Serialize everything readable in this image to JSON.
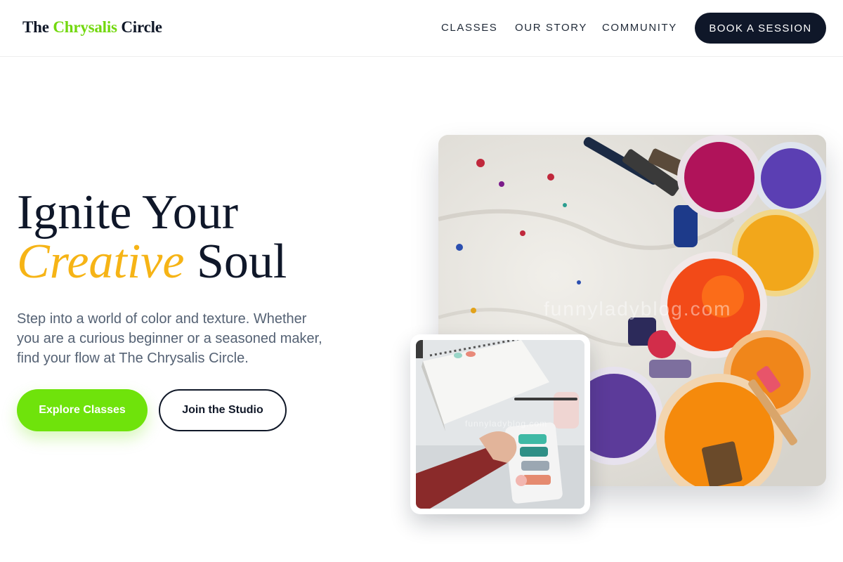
{
  "header": {
    "logo": {
      "prefix": "The",
      "accent": "Chrysalis",
      "suffix": "Circle"
    },
    "nav": {
      "classes": "CLASSES",
      "story": "OUR STORY",
      "community": "COMMUNITY"
    },
    "cta": "BOOK A SESSION"
  },
  "hero": {
    "headline_line1": "Ignite Your",
    "headline_accent": "Creative",
    "headline_line2_rest": "Soul",
    "subtext": "Step into a world of color and texture. Whether you are a curious beginner or a seasoned maker, find your flow at The Chrysalis Circle.",
    "primary_button": "Explore Classes",
    "secondary_button": "Join the Studio"
  },
  "images": {
    "main_watermark": "funnyladyblog.com",
    "small_watermark": "funnyladyblog.com"
  },
  "colors": {
    "brand_green": "#6fe30b",
    "accent_yellow": "#f6b416",
    "navy": "#0f1729"
  }
}
